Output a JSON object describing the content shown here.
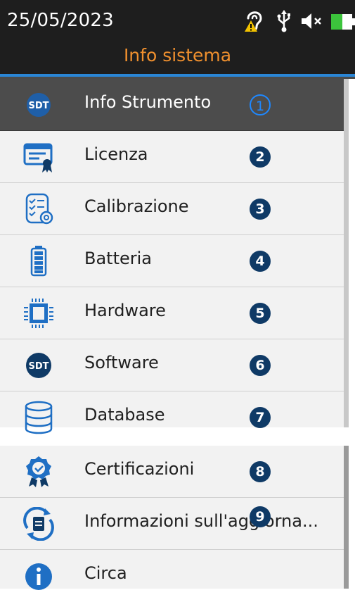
{
  "status_bar": {
    "date": "25/05/2023",
    "icons": [
      "hearing-warning-icon",
      "usb-icon",
      "speaker-mute-icon",
      "battery-icon"
    ]
  },
  "title": "Info sistema",
  "colors": {
    "header_bg": "#1e1e1e",
    "title": "#f0902e",
    "accent_blue": "#2a86d6",
    "selected_bg": "#4c4c4c",
    "badge_bg": "#0f3a66",
    "badge_selected": "#1e88ff"
  },
  "menu": {
    "items": [
      {
        "label": "Info Strumento",
        "number": "1",
        "icon": "sdt-logo-icon"
      },
      {
        "label": "Licenza",
        "number": "2",
        "icon": "license-certificate-icon"
      },
      {
        "label": "Calibrazione",
        "number": "3",
        "icon": "calibration-checklist-icon"
      },
      {
        "label": "Batteria",
        "number": "4",
        "icon": "battery-full-icon"
      },
      {
        "label": "Hardware",
        "number": "5",
        "icon": "chip-icon"
      },
      {
        "label": "Software",
        "number": "6",
        "icon": "sdt-logo-icon"
      },
      {
        "label": "Database",
        "number": "7",
        "icon": "database-icon"
      },
      {
        "label": "Certificazioni",
        "number": "8",
        "icon": "certification-badge-icon"
      },
      {
        "label": "Informazioni sull'aggiorna...",
        "number": "9",
        "icon": "update-document-icon"
      },
      {
        "label": "Circa",
        "number": "",
        "icon": "info-icon"
      }
    ]
  }
}
